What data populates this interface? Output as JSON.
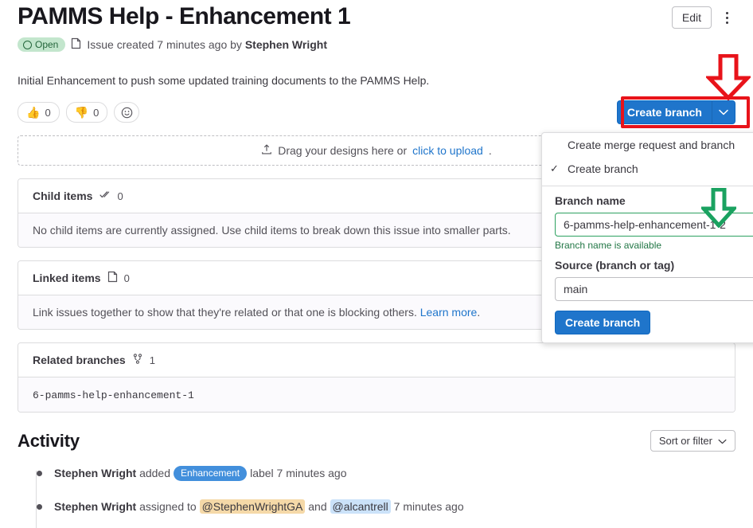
{
  "header": {
    "title": "PAMMS Help - Enhancement 1",
    "edit_label": "Edit",
    "more_actions": "more-actions"
  },
  "meta": {
    "status_badge": "Open",
    "created_prefix": "Issue created 7 minutes ago by",
    "author": "Stephen Wright"
  },
  "description": {
    "text": "Initial Enhancement to push some updated training documents to the PAMMS Help."
  },
  "reactions": [
    {
      "emoji": "👍",
      "count": "0",
      "name": "thumbsup-reaction"
    },
    {
      "emoji": "👎",
      "count": "0",
      "name": "thumbsdown-reaction"
    }
  ],
  "add_reaction_icon": "smiley-icon",
  "dropzone": {
    "text_before": "Drag your designs here or",
    "link": "click to upload",
    "text_after": "."
  },
  "cards": [
    {
      "title": "Child items",
      "icon": "child-items-icon",
      "count": "0",
      "body": "No child items are currently assigned. Use child items to break down this issue into smaller parts.",
      "body_link": "",
      "body_after": ""
    },
    {
      "title": "Linked items",
      "icon": "linked-items-icon",
      "count": "0",
      "body": "Link issues together to show that they're related or that one is blocking others.",
      "body_link": "Learn more",
      "body_after": "."
    },
    {
      "title": "Related branches",
      "icon": "branch-icon",
      "count": "1",
      "body": "6-pamms-help-enhancement-1",
      "body_link": "",
      "body_after": ""
    }
  ],
  "activity": {
    "title": "Activity",
    "sort_filter_label": "Sort or filter",
    "notes": [
      {
        "author": "Stephen Wright",
        "action": "added",
        "label": "Enhancement",
        "suffix": "label 7 minutes ago"
      },
      {
        "author": "Stephen Wright",
        "action": "assigned to",
        "mention_1": "@StephenWrightGA",
        "conjunction": "and",
        "mention_2": "@alcantrell",
        "suffix": "7 minutes ago"
      }
    ]
  },
  "create_branch_button": {
    "label": "Create branch",
    "toggle_icon": "chevron-down-icon"
  },
  "dropdown": {
    "option_merge_request": "Create merge request and branch",
    "option_create_branch": "Create branch",
    "selected_check": "✓",
    "branch_name_label": "Branch name",
    "branch_name_value": "6-pamms-help-enhancement-1-2",
    "branch_name_help": "Branch name is available",
    "source_label": "Source (branch or tag)",
    "source_value": "main",
    "submit_label": "Create branch"
  },
  "annotations": {
    "highlight_color": "#e8131a",
    "arrow_red": "down-arrow-red",
    "arrow_green": "down-arrow-green",
    "arrow_green_color": "#1aa260"
  }
}
